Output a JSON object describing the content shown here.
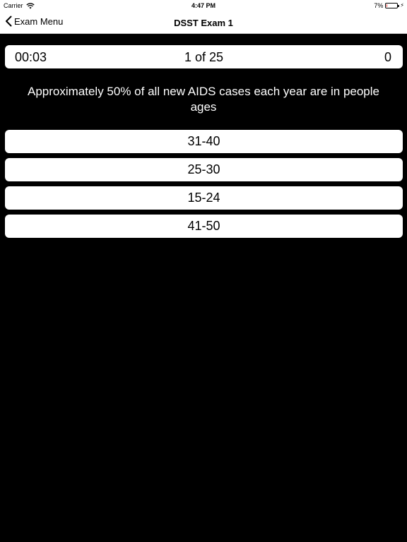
{
  "status_bar": {
    "carrier": "Carrier",
    "time": "4:47 PM",
    "battery": "7%",
    "battery_level": 0.07,
    "icons": [
      "wifi-icon",
      "battery-icon",
      "charging-bolt-icon"
    ]
  },
  "nav": {
    "back_label": "Exam Menu",
    "title": "DSST Exam 1"
  },
  "info": {
    "timer": "00:03",
    "progress": "1 of 25",
    "score": "0"
  },
  "question": {
    "text": "Approximately 50% of all new AIDS cases each year are in people ages"
  },
  "answers": [
    {
      "label": "31-40"
    },
    {
      "label": "25-30"
    },
    {
      "label": "15-24"
    },
    {
      "label": "41-50"
    }
  ],
  "colors": {
    "background": "#000000",
    "surface": "#ffffff",
    "battery_low": "#e0302a"
  }
}
